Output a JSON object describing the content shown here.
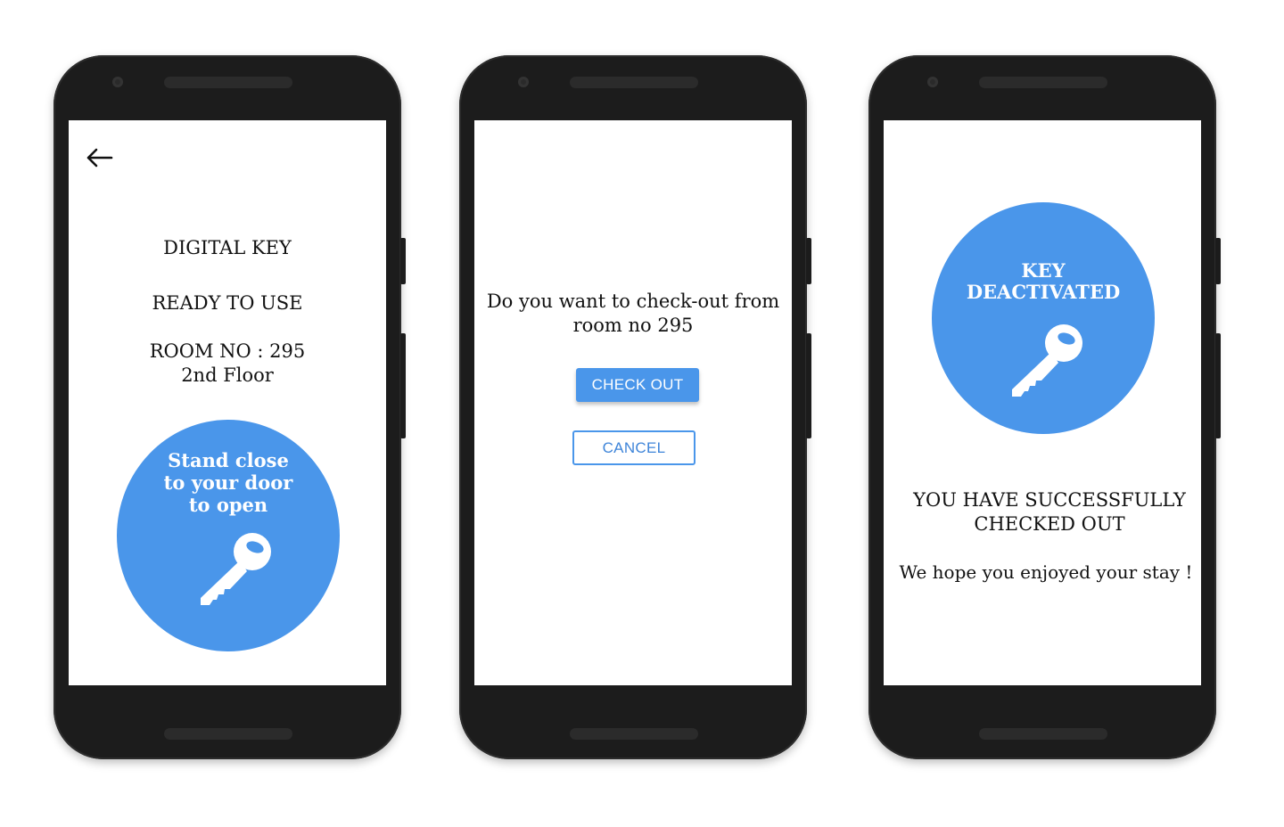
{
  "colors": {
    "accent": "#4a96ea",
    "phone_body": "#1c1c1c",
    "screen": "#ffffff"
  },
  "screen1": {
    "back_icon": "arrow-left-icon",
    "title": "DIGITAL KEY",
    "status": "READY TO USE",
    "room": "ROOM NO : 295",
    "floor": "2nd Floor",
    "circle_line1": "Stand close",
    "circle_line2": "to your door",
    "circle_line3": "to open",
    "key_icon": "key-icon"
  },
  "screen2": {
    "question_line1": "Do you want to check-out from",
    "question_line2": "room no 295",
    "checkout_label": "CHECK OUT",
    "cancel_label": "CANCEL"
  },
  "screen3": {
    "circle_line1": "KEY",
    "circle_line2": "DEACTIVATED",
    "key_icon": "key-icon",
    "success_line1": "YOU HAVE SUCCESSFULLY",
    "success_line2": "CHECKED OUT",
    "farewell": "We hope you enjoyed your stay !"
  }
}
